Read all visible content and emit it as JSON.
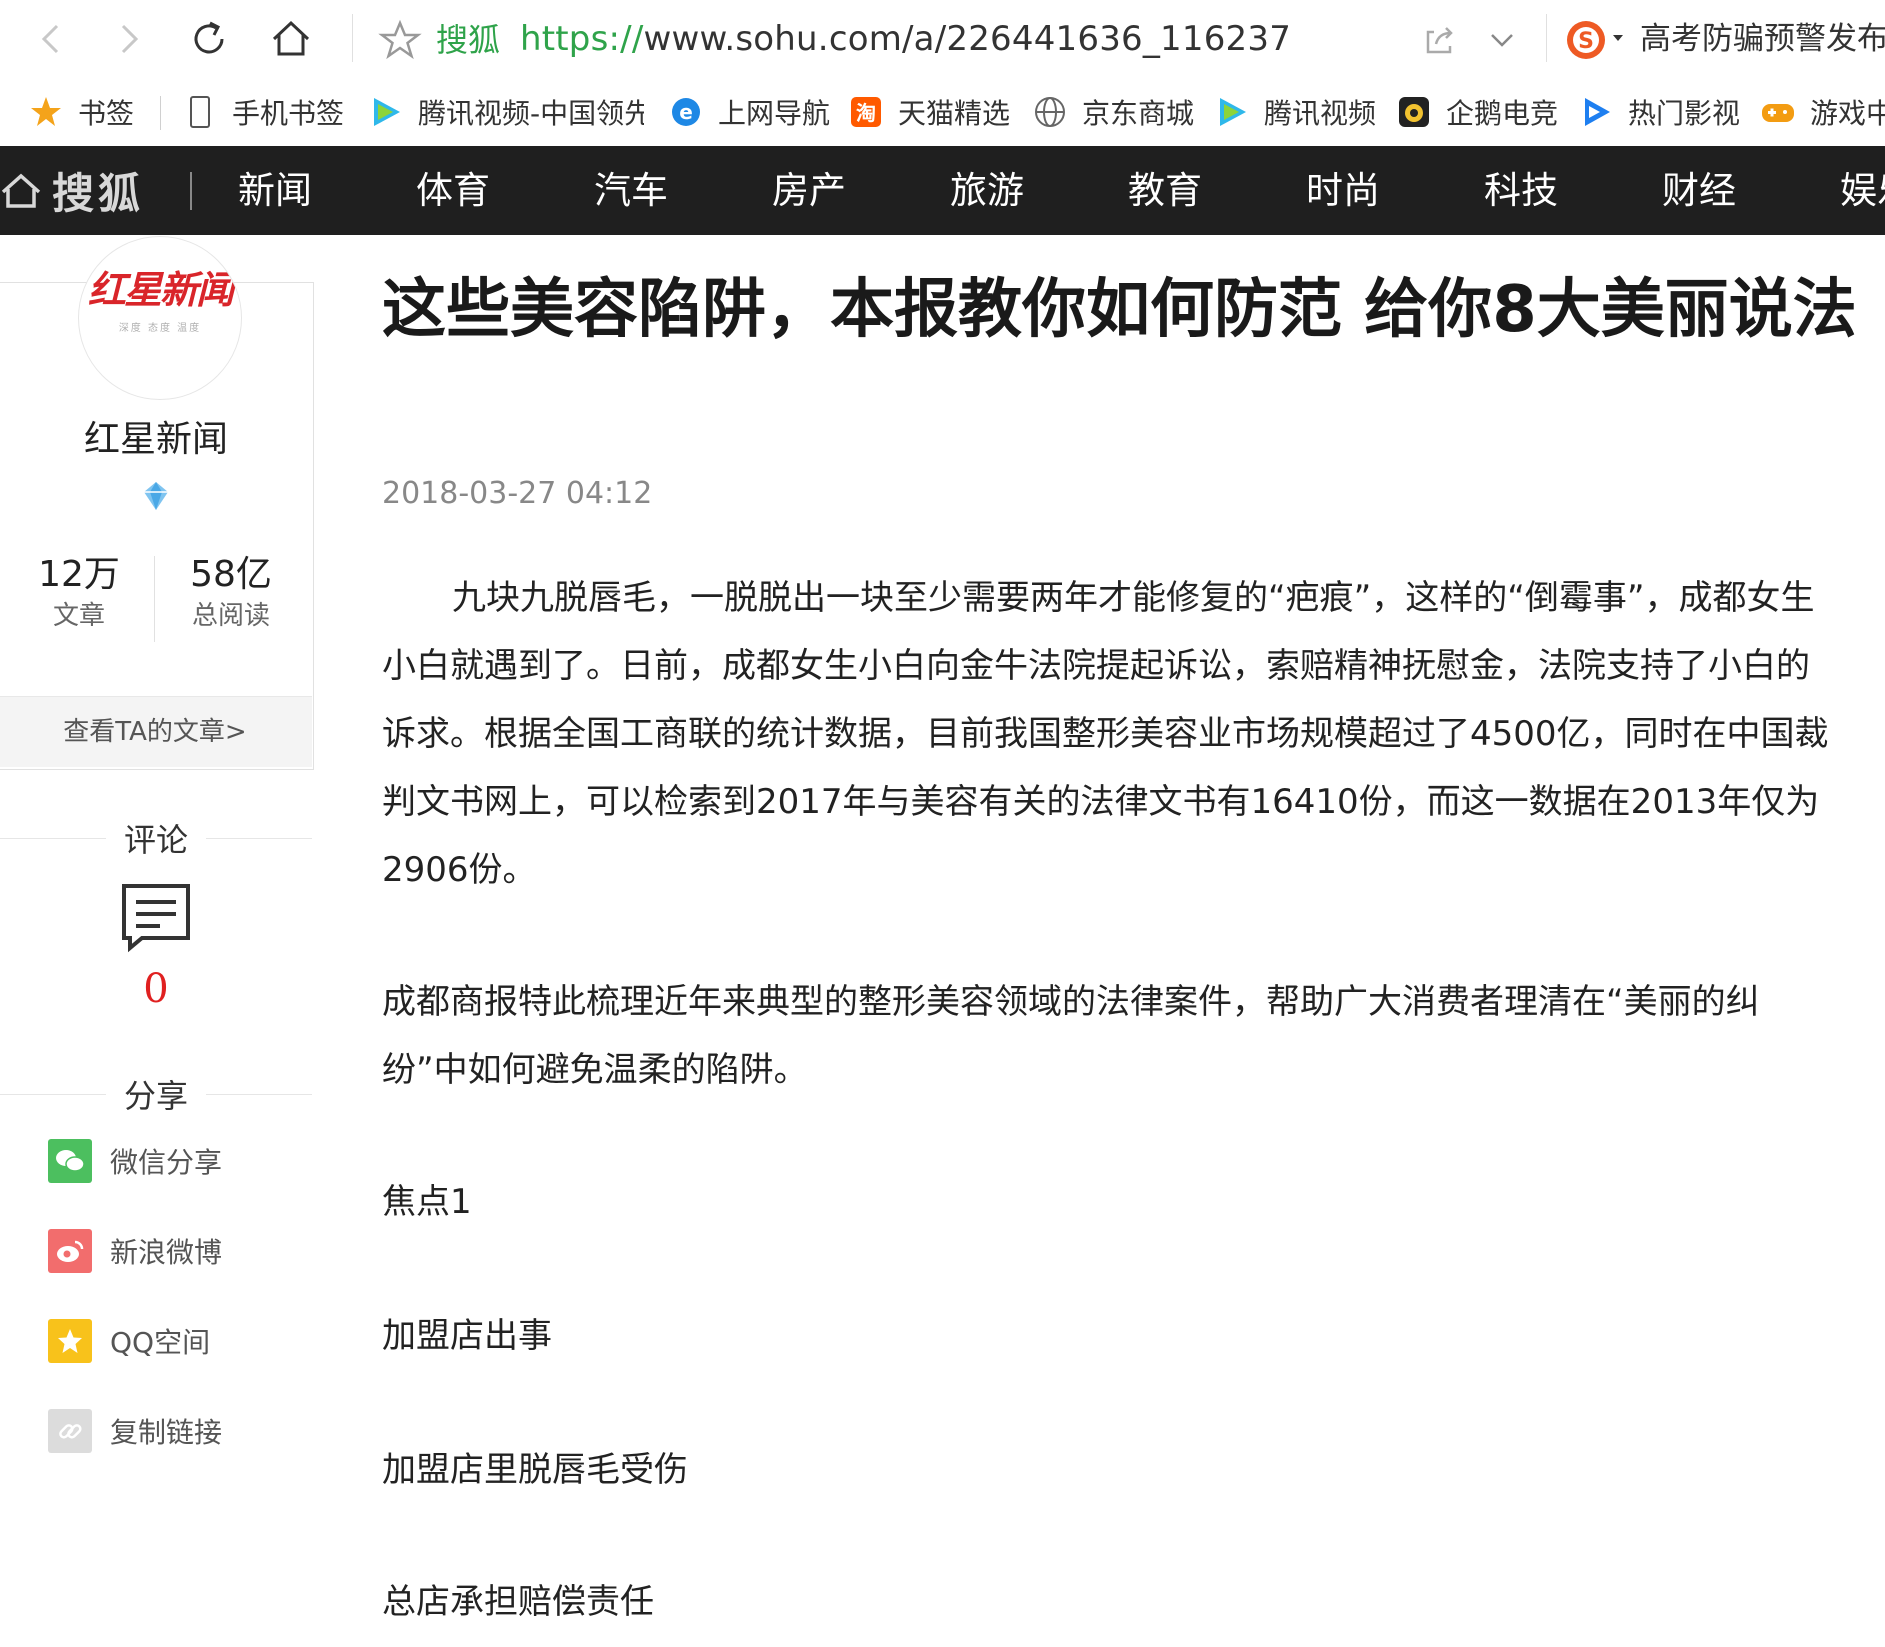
{
  "browser": {
    "site_name": "搜狐",
    "url_scheme": "https://",
    "url_rest": "www.sohu.com/a/226441636_116237",
    "ticker": "高考防骗预警发布"
  },
  "bookmarks": [
    {
      "label": "书签",
      "icon": "star-icon"
    },
    {
      "label": "手机书签",
      "icon": "phone-icon"
    },
    {
      "label": "腾讯视频-中国领先",
      "icon": "tencent-video-icon"
    },
    {
      "label": "上网导航",
      "icon": "ie-icon"
    },
    {
      "label": "天猫精选",
      "icon": "tmall-icon"
    },
    {
      "label": "京东商城",
      "icon": "globe-icon"
    },
    {
      "label": "腾讯视频",
      "icon": "tencent-video-icon"
    },
    {
      "label": "企鹅电竞",
      "icon": "penguin-esports-icon"
    },
    {
      "label": "热门影视",
      "icon": "play-icon"
    },
    {
      "label": "游戏中",
      "icon": "gamepad-icon"
    }
  ],
  "channel_nav": {
    "brand": "搜狐",
    "items": [
      "新闻",
      "体育",
      "汽车",
      "房产",
      "旅游",
      "教育",
      "时尚",
      "科技",
      "财经",
      "娱乐"
    ]
  },
  "author": {
    "logo_text": "红星新闻",
    "logo_sub": "深度 态度 温度",
    "name": "红星新闻",
    "articles_count": "12万",
    "articles_label": "文章",
    "reads_count": "58亿",
    "reads_label": "总阅读",
    "view_articles": "查看TA的文章>"
  },
  "comments": {
    "title": "评论",
    "count": "0"
  },
  "share": {
    "title": "分享",
    "items": [
      {
        "label": "微信分享",
        "icon": "wechat-icon",
        "color": "#4cbf5f"
      },
      {
        "label": "新浪微博",
        "icon": "weibo-icon",
        "color": "#f26d6d"
      },
      {
        "label": "QQ空间",
        "icon": "qzone-icon",
        "color": "#f8c21b"
      },
      {
        "label": "复制链接",
        "icon": "link-icon",
        "color": "#dcdcdc"
      }
    ]
  },
  "article": {
    "title": "这些美容陷阱，本报教你如何防范 给你8大美丽说法",
    "time": "2018-03-27 04:12",
    "paragraphs": [
      "九块九脱唇毛，一脱脱出一块至少需要两年才能修复的“疤痕”，这样的“倒霉事”，成都女生小白就遇到了。日前，成都女生小白向金牛法院提起诉讼，索赔精神抚慰金，法院支持了小白的诉求。根据全国工商联的统计数据，目前我国整形美容业市场规模超过了4500亿，同时在中国裁判文书网上，可以检索到2017年与美容有关的法律文书有16410份，而这一数据在2013年仅为2906份。",
      "成都商报特此梳理近年来典型的整形美容领域的法律案件，帮助广大消费者理清在“美丽的纠纷”中如何避免温柔的陷阱。"
    ],
    "lines": [
      "焦点1",
      "加盟店出事",
      "加盟店里脱唇毛受伤",
      "总店承担赔偿责任"
    ]
  },
  "colors": {
    "nav_bg": "#1f1f1f",
    "url_green": "#2fa34a",
    "comment_red": "#e02020"
  }
}
